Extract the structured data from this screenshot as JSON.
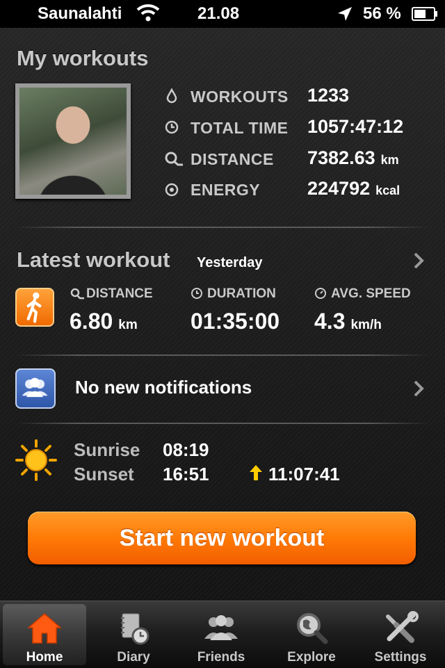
{
  "status_bar": {
    "carrier": "Saunalahti",
    "time": "21.08",
    "battery": "56 %"
  },
  "my_workouts": {
    "title": "My workouts",
    "stats": [
      {
        "label": "WORKOUTS",
        "value": "1233",
        "unit": "",
        "icon": "drop-icon"
      },
      {
        "label": "TOTAL TIME",
        "value": "1057:47:12",
        "unit": "",
        "icon": "clock-icon"
      },
      {
        "label": "DISTANCE",
        "value": "7382.63",
        "unit": "km",
        "icon": "distance-icon"
      },
      {
        "label": "ENERGY",
        "value": "224792",
        "unit": "kcal",
        "icon": "energy-icon"
      }
    ]
  },
  "latest_workout": {
    "title": "Latest workout",
    "when": "Yesterday",
    "metrics": [
      {
        "label": "DISTANCE",
        "value": "6.80",
        "unit": "km"
      },
      {
        "label": "DURATION",
        "value": "01:35:00",
        "unit": ""
      },
      {
        "label": "AVG. SPEED",
        "value": "4.3",
        "unit": "km/h"
      }
    ]
  },
  "notifications": {
    "text": "No new notifications"
  },
  "sun": {
    "sunrise_label": "Sunrise",
    "sunrise": "08:19",
    "sunset_label": "Sunset",
    "sunset": "16:51",
    "daylight": "11:07:41"
  },
  "start_button": "Start new workout",
  "tabs": [
    {
      "label": "Home",
      "icon": "home-icon",
      "active": true
    },
    {
      "label": "Diary",
      "icon": "diary-icon",
      "active": false
    },
    {
      "label": "Friends",
      "icon": "friends-icon",
      "active": false
    },
    {
      "label": "Explore",
      "icon": "explore-icon",
      "active": false
    },
    {
      "label": "Settings",
      "icon": "settings-icon",
      "active": false
    }
  ],
  "colors": {
    "accent_orange": "#ff7a06",
    "notification_blue": "#3c64b4",
    "background": "#1a1a1a"
  }
}
